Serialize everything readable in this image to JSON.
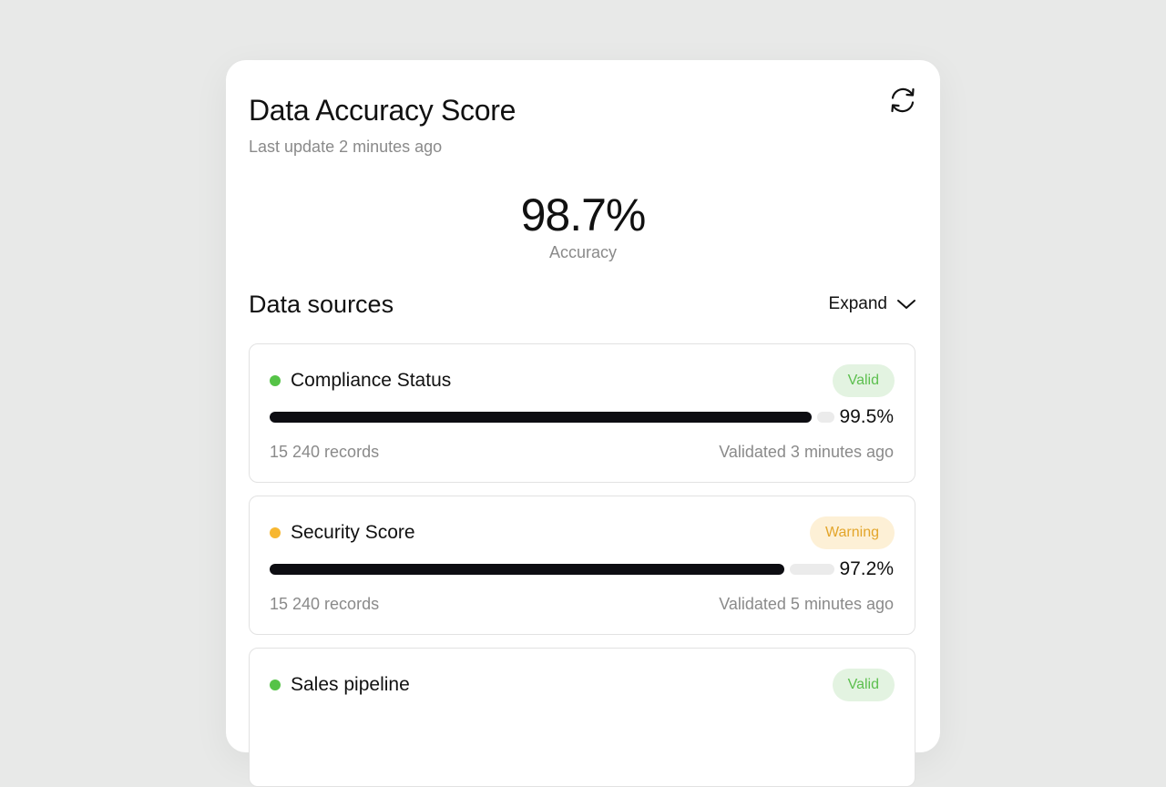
{
  "header": {
    "title": "Data Accuracy Score",
    "subtitle": "Last update 2 minutes ago",
    "refresh_icon": "refresh-icon"
  },
  "score": {
    "value": "98.7%",
    "label": "Accuracy"
  },
  "sources_section": {
    "title": "Data sources",
    "expand_label": "Expand",
    "expand_icon": "chevron-down-icon"
  },
  "colors": {
    "valid_dot": "#55c347",
    "warning_dot": "#f7b731",
    "bar_fill": "#0d0d12"
  },
  "sources": [
    {
      "name": "Compliance Status",
      "status": "Valid",
      "percent": "99.5%",
      "progress": 0.995,
      "records": "15 240 records",
      "validated": "Validated 3 minutes ago"
    },
    {
      "name": "Security Score",
      "status": "Warning",
      "percent": "97.2%",
      "progress": 0.972,
      "records": "15 240 records",
      "validated": "Validated 5 minutes ago"
    },
    {
      "name": "Sales pipeline",
      "status": "Valid"
    }
  ]
}
